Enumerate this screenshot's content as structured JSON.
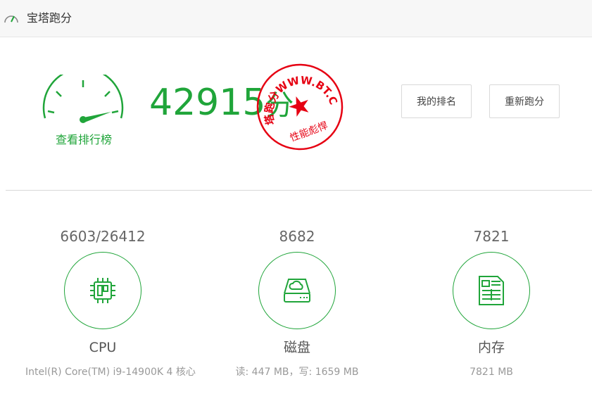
{
  "header": {
    "title": "宝塔跑分",
    "icon": "speedometer-icon"
  },
  "score": {
    "value": "42915",
    "unit": "分",
    "rank_link": "查看排行榜"
  },
  "stamp": {
    "top_text": "宝塔跑分WWW.BT.CN",
    "bottom_text": "性能彪悍",
    "color": "#e60012"
  },
  "buttons": {
    "my_rank": "我的排名",
    "rerun": "重新跑分"
  },
  "metrics": [
    {
      "value": "6603/26412",
      "name": "CPU",
      "desc": "Intel(R) Core(TM) i9-14900K 4 核心",
      "icon": "cpu-chip-icon"
    },
    {
      "value": "8682",
      "name": "磁盘",
      "desc": "读: 447 MB，写: 1659 MB",
      "icon": "disk-drive-icon"
    },
    {
      "value": "7821",
      "name": "内存",
      "desc": "7821 MB",
      "icon": "memory-icon"
    }
  ],
  "colors": {
    "accent": "#20a53a",
    "stamp_red": "#e60012"
  }
}
